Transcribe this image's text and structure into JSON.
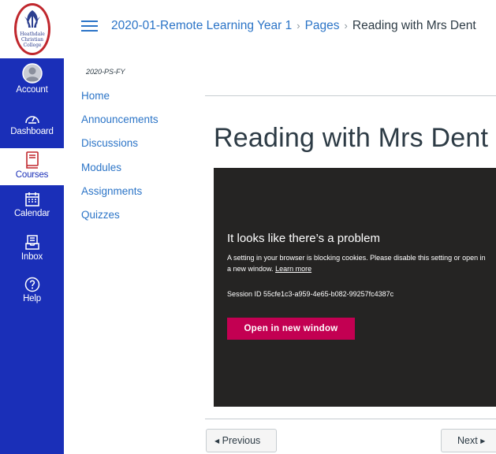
{
  "logo": {
    "text_lines": [
      "Heathdale",
      "Christian",
      "College"
    ]
  },
  "global_nav": {
    "items": [
      {
        "label": "Account",
        "icon": "account-avatar-icon"
      },
      {
        "label": "Dashboard",
        "icon": "dashboard-gauge-icon"
      },
      {
        "label": "Courses",
        "icon": "courses-book-icon"
      },
      {
        "label": "Calendar",
        "icon": "calendar-icon"
      },
      {
        "label": "Inbox",
        "icon": "inbox-icon"
      },
      {
        "label": "Help",
        "icon": "help-icon"
      }
    ]
  },
  "breadcrumb": {
    "course": "2020-01-Remote Learning Year 1",
    "section": "Pages",
    "current": "Reading with Mrs Dent"
  },
  "course_nav": {
    "term": "2020-PS-FY",
    "items": [
      "Home",
      "Announcements",
      "Discussions",
      "Modules",
      "Assignments",
      "Quizzes"
    ]
  },
  "page": {
    "title": "Reading with Mrs Dent"
  },
  "embed": {
    "heading": "It looks like there’s a problem",
    "message": "A setting in your browser is blocking cookies. Please disable this setting or open in a new window.",
    "learn_more": "Learn more",
    "session": "Session ID 55cfe1c3-a959-4e65-b082-99257fc4387c",
    "button": "Open in new window"
  },
  "pager": {
    "prev": "Previous",
    "next": "Next"
  },
  "colors": {
    "nav_bg": "#1a2fb8",
    "link": "#2b74c7",
    "embed_bg": "#252423",
    "embed_button": "#c30052"
  }
}
